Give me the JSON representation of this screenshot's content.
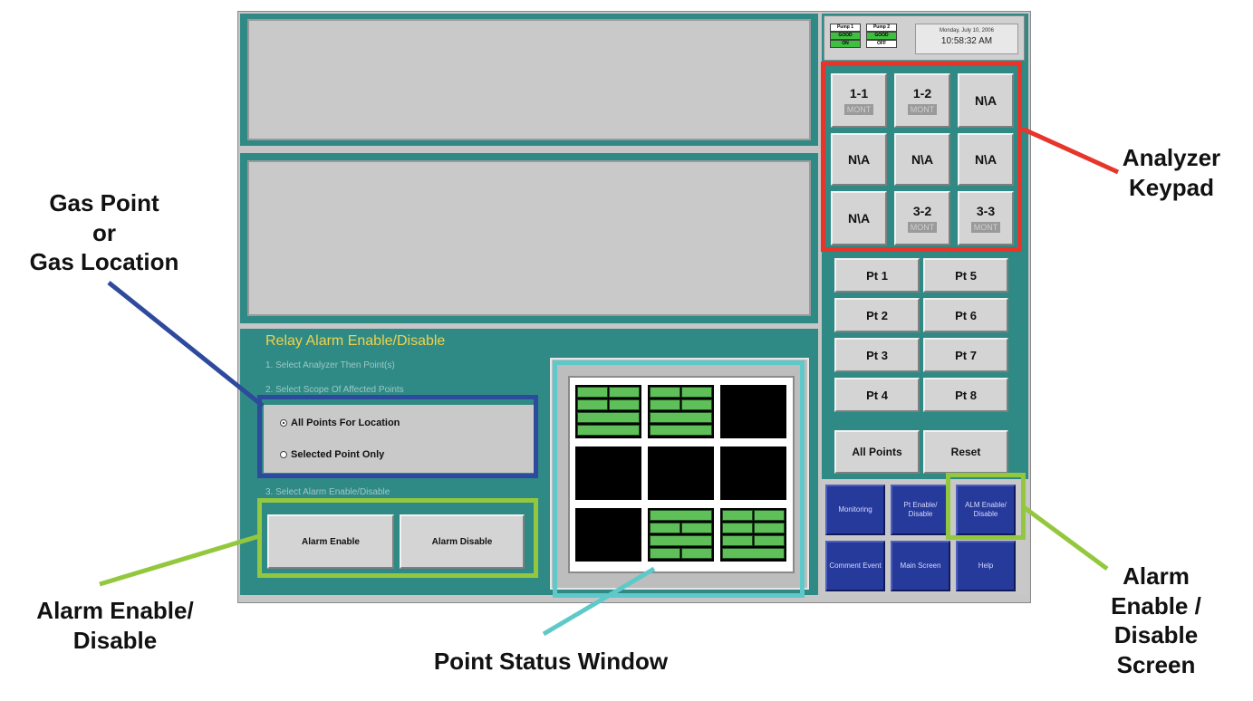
{
  "relay": {
    "title": "Relay Alarm Enable/Disable",
    "step1": "1.  Select Analyzer Then Point(s)",
    "step2": "2.  Select Scope Of Affected Points",
    "step3": "3.  Select Alarm Enable/Disable",
    "radio_all": "All Points For Location",
    "radio_selected": "Selected Point Only",
    "alarm_enable": "Alarm Enable",
    "alarm_disable": "Alarm Disable"
  },
  "status": {
    "pump1_label": "Pump 1",
    "pump1_state": "GOOD",
    "pump1_power": "ON",
    "pump2_label": "Pump 2",
    "pump2_state": "GOOD",
    "pump2_power": "OFF",
    "date": "Monday, July 10, 2006",
    "time": "10:58:32 AM"
  },
  "keypad": {
    "k11": "1-1",
    "k12": "1-2",
    "k13": "N\\A",
    "k21": "N\\A",
    "k22": "N\\A",
    "k23": "N\\A",
    "k31": "N\\A",
    "k32": "3-2",
    "k33": "3-3",
    "mont": "MONT"
  },
  "points": {
    "pt1": "Pt 1",
    "pt2": "Pt 2",
    "pt3": "Pt 3",
    "pt4": "Pt 4",
    "pt5": "Pt 5",
    "pt6": "Pt 6",
    "pt7": "Pt 7",
    "pt8": "Pt 8",
    "all": "All Points",
    "reset": "Reset"
  },
  "nav": {
    "monitoring": "Monitoring",
    "pt_enable": "Pt Enable/ Disable",
    "alm_enable": "ALM Enable/ Disable",
    "comment": "Comment Event",
    "main": "Main Screen",
    "help": "Help"
  },
  "callouts": {
    "gas_point": "Gas Point\nor\nGas Location",
    "analyzer": "Analyzer\nKeypad",
    "alarm_enable": "Alarm Enable/\nDisable",
    "point_status": "Point Status Window",
    "alarm_screen": "Alarm\nEnable /\nDisable\nScreen"
  },
  "colors": {
    "analyzer_outline": "#e8352a",
    "gas_outline": "#2e4a9c",
    "alarm_outline": "#93c83e",
    "status_outline": "#5fc9c9"
  }
}
